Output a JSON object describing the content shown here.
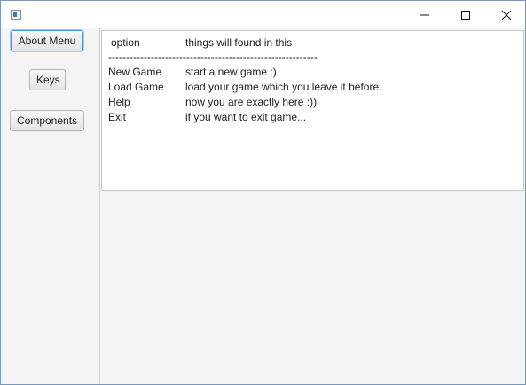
{
  "window": {
    "title": ""
  },
  "sidebar": {
    "buttons": [
      {
        "label": "About Menu"
      },
      {
        "label": "Keys"
      },
      {
        "label": "Components"
      }
    ]
  },
  "text_area": {
    "header": {
      "option": "option",
      "description": "things will found in this"
    },
    "separator": "-----------------------------------------------------------",
    "rows": [
      {
        "option": "New Game",
        "description": "start a new game :)"
      },
      {
        "option": "Load Game",
        "description": "load your game which you leave it before."
      },
      {
        "option": "Help",
        "description": "now you are exactly here :))"
      },
      {
        "option": "Exit",
        "description": "if you want to exit game..."
      }
    ]
  },
  "colors": {
    "focus_border": "#3e9ad1",
    "window_border": "#7a98b8",
    "panel_background": "#f4f4f4"
  }
}
